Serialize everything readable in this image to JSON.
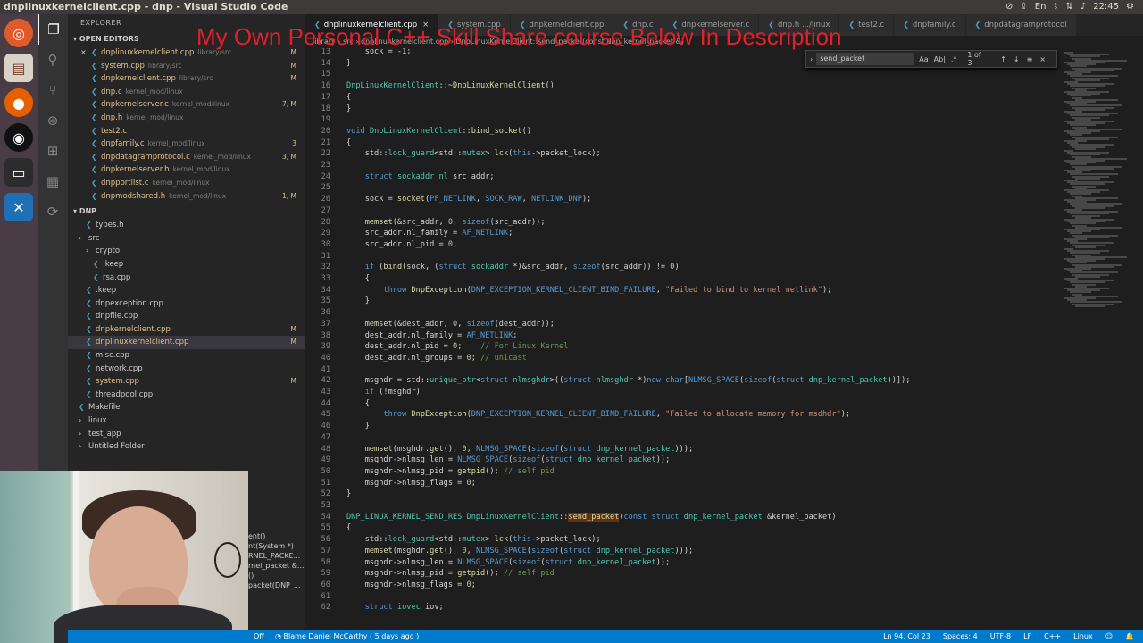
{
  "window_title": "dnplinuxkernelclient.cpp - dnp - Visual Studio Code",
  "tray": {
    "time": "22:45",
    "lang": "En"
  },
  "overlay_text": "My Own Personal C++ Skill Share course Below In Description",
  "explorer": {
    "title": "EXPLORER",
    "open_editors_label": "OPEN EDITORS",
    "open_editors": [
      {
        "name": "dnplinuxkernelclient.cpp",
        "dir": "library/src",
        "badge": "M",
        "close": "×"
      },
      {
        "name": "system.cpp",
        "dir": "library/src",
        "badge": "M"
      },
      {
        "name": "dnpkernelclient.cpp",
        "dir": "library/src",
        "badge": "M"
      },
      {
        "name": "dnp.c",
        "dir": "kernel_mod/linux",
        "badge": ""
      },
      {
        "name": "dnpkernelserver.c",
        "dir": "kernel_mod/linux",
        "badge": "7, M"
      },
      {
        "name": "dnp.h",
        "dir": "kernel_mod/linux",
        "badge": ""
      },
      {
        "name": "test2.c",
        "dir": "",
        "badge": ""
      },
      {
        "name": "dnpfamily.c",
        "dir": "kernel_mod/linux",
        "badge": "3"
      },
      {
        "name": "dnpdatagramprotocol.c",
        "dir": "kernel_mod/linux",
        "badge": "3, M"
      },
      {
        "name": "dnpkernelserver.h",
        "dir": "kernel_mod/linux",
        "badge": ""
      },
      {
        "name": "dnpportlist.c",
        "dir": "kernel_mod/linux",
        "badge": ""
      },
      {
        "name": "dnpmodshared.h",
        "dir": "kernel_mod/linux",
        "badge": "1, M"
      }
    ],
    "folder_label": "DNP",
    "tree": [
      {
        "name": "types.h",
        "indent": 20,
        "badge": ""
      },
      {
        "name": "src",
        "indent": 12,
        "badge": "",
        "folder": true
      },
      {
        "name": "crypto",
        "indent": 20,
        "badge": "",
        "folder": true
      },
      {
        "name": ".keep",
        "indent": 28,
        "badge": ""
      },
      {
        "name": "rsa.cpp",
        "indent": 28,
        "badge": ""
      },
      {
        "name": ".keep",
        "indent": 20,
        "badge": ""
      },
      {
        "name": "dnpexception.cpp",
        "indent": 20,
        "badge": ""
      },
      {
        "name": "dnpfile.cpp",
        "indent": 20,
        "badge": ""
      },
      {
        "name": "dnpkernelclient.cpp",
        "indent": 20,
        "badge": "M"
      },
      {
        "name": "dnplinuxkernelclient.cpp",
        "indent": 20,
        "badge": "M",
        "selected": true
      },
      {
        "name": "misc.cpp",
        "indent": 20,
        "badge": ""
      },
      {
        "name": "network.cpp",
        "indent": 20,
        "badge": ""
      },
      {
        "name": "system.cpp",
        "indent": 20,
        "badge": "M"
      },
      {
        "name": "threadpool.cpp",
        "indent": 20,
        "badge": ""
      },
      {
        "name": "Makefile",
        "indent": 12,
        "badge": ""
      },
      {
        "name": "linux",
        "indent": 12,
        "badge": "",
        "folder": true
      },
      {
        "name": "test_app",
        "indent": 12,
        "badge": "",
        "folder": true
      },
      {
        "name": "Untitled Folder",
        "indent": 12,
        "badge": "",
        "folder": true
      }
    ]
  },
  "tabs": [
    {
      "label": "dnplinuxkernelclient.cpp",
      "active": true
    },
    {
      "label": "system.cpp"
    },
    {
      "label": "dnpkernelclient.cpp"
    },
    {
      "label": "dnp.c"
    },
    {
      "label": "dnpkernelserver.c"
    },
    {
      "label": "dnp.h  .../linux"
    },
    {
      "label": "test2.c"
    },
    {
      "label": "dnpfamily.c"
    },
    {
      "label": "dnpdatagramprotocol"
    }
  ],
  "breadcrumb": "library › src › dnplinuxkernelclient.cpp › DnpLinuxKernelClient::send_packet(const dnp_kernel_packet &)",
  "find": {
    "query": "send_packet",
    "opt1": "Aa",
    "opt2": "Ab|",
    "opt3": ".*",
    "count": "1 of 3",
    "nav": "↑↓≡×"
  },
  "code_lines": [
    {
      "n": "13",
      "html": "    <span>sock = -1;</span>"
    },
    {
      "n": "14",
      "html": "}"
    },
    {
      "n": "15",
      "html": ""
    },
    {
      "n": "16",
      "html": "<span class='ty'>DnpLinuxKernelClient</span>::~<span class='fnc'>DnpLinuxKernelClient</span>()"
    },
    {
      "n": "17",
      "html": "{"
    },
    {
      "n": "18",
      "html": "}"
    },
    {
      "n": "19",
      "html": ""
    },
    {
      "n": "20",
      "html": "<span class='kw'>void</span> <span class='ty'>DnpLinuxKernelClient</span>::<span class='fnc'>bind_socket</span>()"
    },
    {
      "n": "21",
      "html": "{"
    },
    {
      "n": "22",
      "html": "    std::<span class='ty'>lock_guard</span>&lt;std::<span class='ty'>mutex</span>&gt; <span class='fnc'>lck</span>(<span class='kw'>this</span>-&gt;packet_lock);"
    },
    {
      "n": "23",
      "html": ""
    },
    {
      "n": "24",
      "html": "    <span class='kw'>struct</span> <span class='ty'>sockaddr_nl</span> src_addr;"
    },
    {
      "n": "25",
      "html": ""
    },
    {
      "n": "26",
      "html": "    sock = <span class='fnc'>socket</span>(<span class='mac'>PF_NETLINK</span>, <span class='mac'>SOCK_RAW</span>, <span class='mac'>NETLINK_DNP</span>);"
    },
    {
      "n": "27",
      "html": ""
    },
    {
      "n": "28",
      "html": "    <span class='fnc'>memset</span>(&amp;src_addr, <span class='num'>0</span>, <span class='kw'>sizeof</span>(src_addr));"
    },
    {
      "n": "29",
      "html": "    src_addr.nl_family = <span class='mac'>AF_NETLINK</span>;"
    },
    {
      "n": "30",
      "html": "    src_addr.nl_pid = <span class='num'>0</span>;"
    },
    {
      "n": "31",
      "html": ""
    },
    {
      "n": "32",
      "html": "    <span class='kw'>if</span> (<span class='fnc'>bind</span>(sock, (<span class='kw'>struct</span> <span class='ty'>sockaddr</span> *)&amp;src_addr, <span class='kw'>sizeof</span>(src_addr)) != <span class='num'>0</span>)"
    },
    {
      "n": "33",
      "html": "    {"
    },
    {
      "n": "34",
      "html": "        <span class='kw'>throw</span> <span class='fnc'>DnpException</span>(<span class='mac'>DNP_EXCEPTION_KERNEL_CLIENT_BIND_FAILURE</span>, <span class='str'>\"Failed to bind to kernel netlink\"</span>);"
    },
    {
      "n": "35",
      "html": "    }"
    },
    {
      "n": "36",
      "html": ""
    },
    {
      "n": "37",
      "html": "    <span class='fnc'>memset</span>(&amp;dest_addr, <span class='num'>0</span>, <span class='kw'>sizeof</span>(dest_addr));"
    },
    {
      "n": "38",
      "html": "    dest_addr.nl_family = <span class='mac'>AF_NETLINK</span>;"
    },
    {
      "n": "39",
      "html": "    dest_addr.nl_pid = <span class='num'>0</span>;    <span class='cm'>// For Linux Kernel</span>"
    },
    {
      "n": "40",
      "html": "    dest_addr.nl_groups = <span class='num'>0</span>; <span class='cm'>// unicast</span>"
    },
    {
      "n": "41",
      "html": ""
    },
    {
      "n": "42",
      "html": "    msghdr = std::<span class='ty'>unique_ptr</span>&lt;<span class='kw'>struct</span> <span class='ty'>nlmsghdr</span>&gt;((<span class='kw'>struct</span> <span class='ty'>nlmsghdr</span> *)<span class='kw'>new</span> <span class='kw'>char</span>[<span class='mac'>NLMSG_SPACE</span>(<span class='kw'>sizeof</span>(<span class='kw'>struct</span> <span class='ty'>dnp_kernel_packet</span>))]);"
    },
    {
      "n": "43",
      "html": "    <span class='kw'>if</span> (!msghdr)"
    },
    {
      "n": "44",
      "html": "    {"
    },
    {
      "n": "45",
      "html": "        <span class='kw'>throw</span> <span class='fnc'>DnpException</span>(<span class='mac'>DNP_EXCEPTION_KERNEL_CLIENT_BIND_FAILURE</span>, <span class='str'>\"Failed to allocate memory for msdhdr\"</span>);"
    },
    {
      "n": "46",
      "html": "    }"
    },
    {
      "n": "47",
      "html": ""
    },
    {
      "n": "48",
      "html": "    <span class='fnc'>memset</span>(msghdr.<span class='fnc'>get</span>(), <span class='num'>0</span>, <span class='mac'>NLMSG_SPACE</span>(<span class='kw'>sizeof</span>(<span class='kw'>struct</span> <span class='ty'>dnp_kernel_packet</span>)));"
    },
    {
      "n": "49",
      "html": "    msghdr-&gt;nlmsg_len = <span class='mac'>NLMSG_SPACE</span>(<span class='kw'>sizeof</span>(<span class='kw'>struct</span> <span class='ty'>dnp_kernel_packet</span>));"
    },
    {
      "n": "50",
      "html": "    msghdr-&gt;nlmsg_pid = <span class='fnc'>getpid</span>(); <span class='cm'>// self pid</span>"
    },
    {
      "n": "51",
      "html": "    msghdr-&gt;nlmsg_flags = <span class='num'>0</span>;"
    },
    {
      "n": "52",
      "html": "}"
    },
    {
      "n": "53",
      "html": ""
    },
    {
      "n": "54",
      "html": "<span class='ty'>DNP_LINUX_KERNEL_SEND_RES</span> <span class='ty'>DnpLinuxKernelClient</span>::<span class='fnc hl'>send_packet</span>(<span class='kw'>const</span> <span class='kw'>struct</span> <span class='ty'>dnp_kernel_packet</span> &amp;kernel_packet)"
    },
    {
      "n": "55",
      "html": "{"
    },
    {
      "n": "56",
      "html": "    std::<span class='ty'>lock_guard</span>&lt;std::<span class='ty'>mutex</span>&gt; <span class='fnc'>lck</span>(<span class='kw'>this</span>-&gt;packet_lock);"
    },
    {
      "n": "57",
      "html": "    <span class='fnc'>memset</span>(msghdr.<span class='fnc'>get</span>(), <span class='num'>0</span>, <span class='mac'>NLMSG_SPACE</span>(<span class='kw'>sizeof</span>(<span class='kw'>struct</span> <span class='ty'>dnp_kernel_packet</span>)));"
    },
    {
      "n": "58",
      "html": "    msghdr-&gt;nlmsg_len = <span class='mac'>NLMSG_SPACE</span>(<span class='kw'>sizeof</span>(<span class='kw'>struct</span> <span class='ty'>dnp_kernel_packet</span>));"
    },
    {
      "n": "59",
      "html": "    msghdr-&gt;nlmsg_pid = <span class='fnc'>getpid</span>(); <span class='cm'>// self pid</span>"
    },
    {
      "n": "60",
      "html": "    msghdr-&gt;nlmsg_flags = <span class='num'>0</span>;"
    },
    {
      "n": "61",
      "html": ""
    },
    {
      "n": "62",
      "html": "    <span class='kw'>struct</span> <span class='ty'>iovec</span> iov;"
    }
  ],
  "behind_webcam": [
    "ent()",
    "nt(System *)",
    "RNEL_PACKE...",
    "rnel_packet &...",
    "()",
    "packet(DNP_..."
  ],
  "status": {
    "left": "Off",
    "blame": "Blame Daniel McCarthy ( 5 days ago )",
    "position": "Ln 94, Col 23",
    "spaces": "Spaces: 4",
    "encoding": "UTF-8",
    "eol": "LF",
    "language": "C++",
    "platform": "Linux"
  }
}
